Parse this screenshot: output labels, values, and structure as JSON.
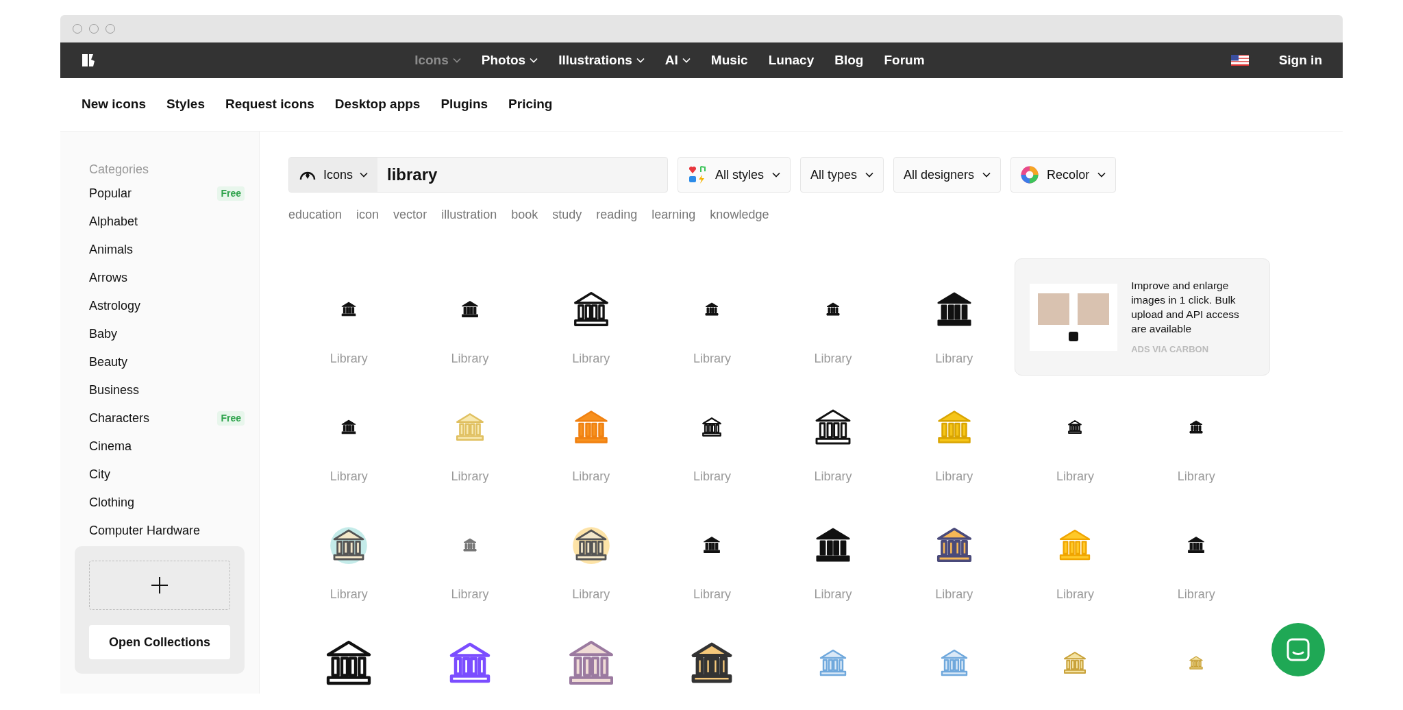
{
  "nav": {
    "items": [
      {
        "label": "Icons",
        "dropdown": true,
        "selected": true
      },
      {
        "label": "Photos",
        "dropdown": true,
        "selected": false
      },
      {
        "label": "Illustrations",
        "dropdown": true,
        "selected": false
      },
      {
        "label": "AI",
        "dropdown": true,
        "selected": false
      },
      {
        "label": "Music",
        "dropdown": false,
        "selected": false
      },
      {
        "label": "Lunacy",
        "dropdown": false,
        "selected": false
      },
      {
        "label": "Blog",
        "dropdown": false,
        "selected": false
      },
      {
        "label": "Forum",
        "dropdown": false,
        "selected": false
      }
    ],
    "sign_in": "Sign in"
  },
  "subnav": [
    "New icons",
    "Styles",
    "Request icons",
    "Desktop apps",
    "Plugins",
    "Pricing"
  ],
  "sidebar": {
    "heading": "Categories",
    "items": [
      {
        "label": "Popular",
        "badge": "Free"
      },
      {
        "label": "Alphabet"
      },
      {
        "label": "Animals"
      },
      {
        "label": "Arrows"
      },
      {
        "label": "Astrology"
      },
      {
        "label": "Baby"
      },
      {
        "label": "Beauty"
      },
      {
        "label": "Business"
      },
      {
        "label": "Characters",
        "badge": "Free"
      },
      {
        "label": "Cinema"
      },
      {
        "label": "City"
      },
      {
        "label": "Clothing"
      },
      {
        "label": "Computer Hardware"
      }
    ],
    "collections_button": "Open Collections"
  },
  "search": {
    "scope": "Icons",
    "value": "library"
  },
  "filters": [
    {
      "label": "All styles",
      "kind": "styles"
    },
    {
      "label": "All types",
      "kind": "plain"
    },
    {
      "label": "All designers",
      "kind": "plain"
    },
    {
      "label": "Recolor",
      "kind": "recolor"
    }
  ],
  "tags": [
    "education",
    "icon",
    "vector",
    "illustration",
    "book",
    "study",
    "reading",
    "learning",
    "knowledge"
  ],
  "results": [
    {
      "kind": "labeled",
      "label": "Library"
    },
    {
      "kind": "labeled",
      "label": "Library"
    },
    {
      "kind": "labeled",
      "label": "Library"
    },
    {
      "kind": "labeled",
      "label": "Library"
    },
    {
      "kind": "labeled",
      "label": "Library"
    },
    {
      "kind": "labeled",
      "label": "Library"
    },
    {
      "kind": "labeled",
      "label": "Library"
    },
    {
      "kind": "labeled",
      "label": "Library"
    },
    {
      "kind": "labeled",
      "label": "Library"
    },
    {
      "kind": "labeled",
      "label": "Library"
    },
    {
      "kind": "labeled",
      "label": "Library"
    },
    {
      "kind": "labeled",
      "label": "Library"
    },
    {
      "kind": "labeled",
      "label": "Library"
    },
    {
      "kind": "labeled",
      "label": "Library"
    },
    {
      "kind": "labeled",
      "label": "Library"
    },
    {
      "kind": "labeled",
      "label": "Library"
    },
    {
      "kind": "labeled",
      "label": "Library"
    },
    {
      "kind": "labeled",
      "label": "Library"
    },
    {
      "kind": "labeled",
      "label": "Library"
    },
    {
      "kind": "labeled",
      "label": "Library"
    },
    {
      "kind": "labeled",
      "label": "Library"
    },
    {
      "kind": "labeled",
      "label": "Library"
    },
    {
      "kind": "cut_off"
    },
    {
      "kind": "cut_off"
    },
    {
      "kind": "cut_off"
    },
    {
      "kind": "cut_off"
    },
    {
      "kind": "cut_off"
    },
    {
      "kind": "cut_off"
    },
    {
      "kind": "cut_off"
    },
    {
      "kind": "cut_off"
    }
  ],
  "ad": {
    "text": "Improve and enlarge images in 1 click. Bulk upload and API access are available",
    "credit": "ADS VIA CARBON"
  }
}
